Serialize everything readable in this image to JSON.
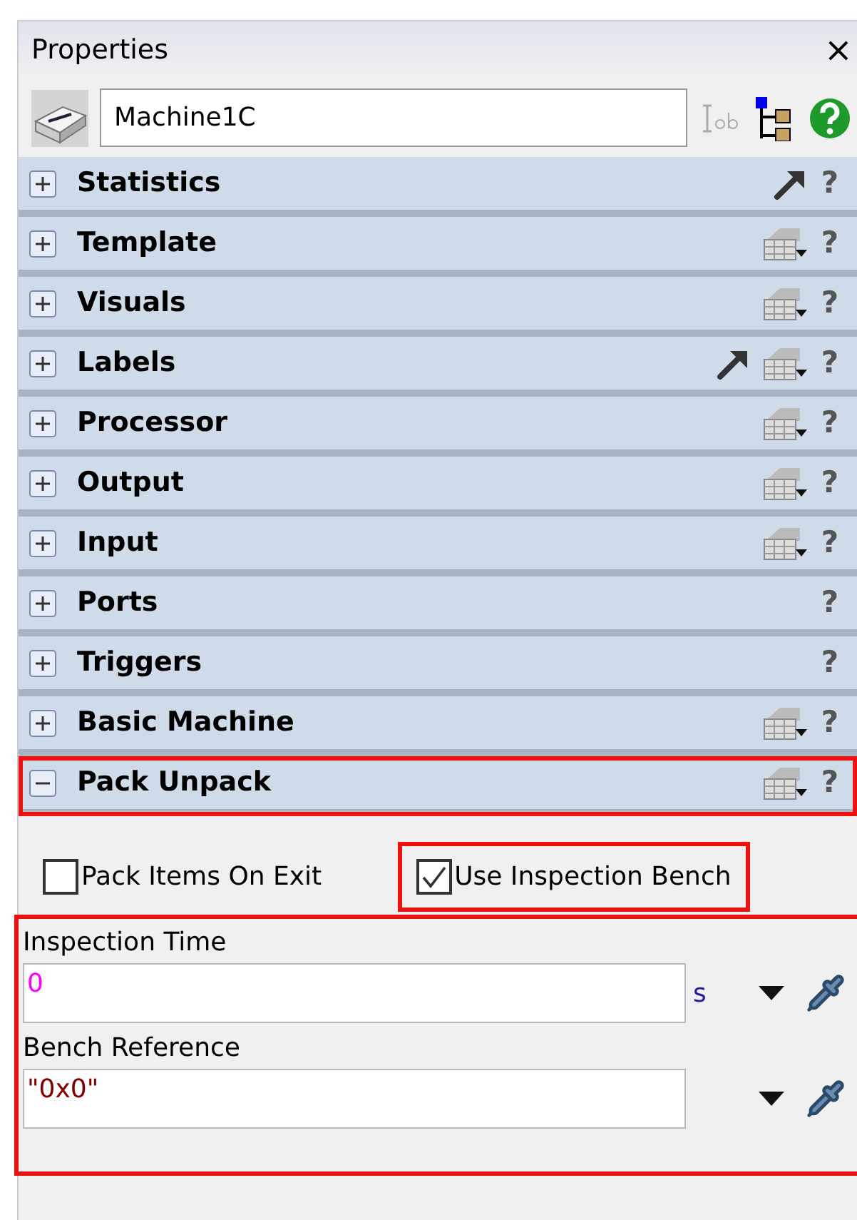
{
  "panel": {
    "title": "Properties",
    "close": "×"
  },
  "object": {
    "name": "Machine1C"
  },
  "sections": [
    {
      "label": "Statistics",
      "expanded": false,
      "arrow": true,
      "template": false,
      "help": "?",
      "highlighted": false
    },
    {
      "label": "Template",
      "expanded": false,
      "arrow": false,
      "template": true,
      "help": "?",
      "highlighted": false
    },
    {
      "label": "Visuals",
      "expanded": false,
      "arrow": false,
      "template": true,
      "help": "?",
      "highlighted": false
    },
    {
      "label": "Labels",
      "expanded": false,
      "arrow": true,
      "template": true,
      "help": "?",
      "highlighted": false
    },
    {
      "label": "Processor",
      "expanded": false,
      "arrow": false,
      "template": true,
      "help": "?",
      "highlighted": false
    },
    {
      "label": "Output",
      "expanded": false,
      "arrow": false,
      "template": true,
      "help": "?",
      "highlighted": false
    },
    {
      "label": "Input",
      "expanded": false,
      "arrow": false,
      "template": true,
      "help": "?",
      "highlighted": false
    },
    {
      "label": "Ports",
      "expanded": false,
      "arrow": false,
      "template": false,
      "help": "?",
      "highlighted": false
    },
    {
      "label": "Triggers",
      "expanded": false,
      "arrow": false,
      "template": false,
      "help": "?",
      "highlighted": false
    },
    {
      "label": "Basic Machine",
      "expanded": false,
      "arrow": false,
      "template": true,
      "help": "?",
      "highlighted": false
    },
    {
      "label": "Pack Unpack",
      "expanded": true,
      "arrow": false,
      "template": true,
      "help": "?",
      "highlighted": true
    }
  ],
  "checkboxes": [
    {
      "label": "Pack Items On Exit",
      "checked": false,
      "highlighted": false
    },
    {
      "label": "Use Inspection Bench",
      "checked": true,
      "highlighted": true
    }
  ],
  "fields_highlighted": true,
  "fields": [
    {
      "label": "Inspection Time",
      "value": "0",
      "kind": "number",
      "unit": "s"
    },
    {
      "label": "Bench Reference",
      "value": "\"0x0\"",
      "kind": "string"
    }
  ]
}
